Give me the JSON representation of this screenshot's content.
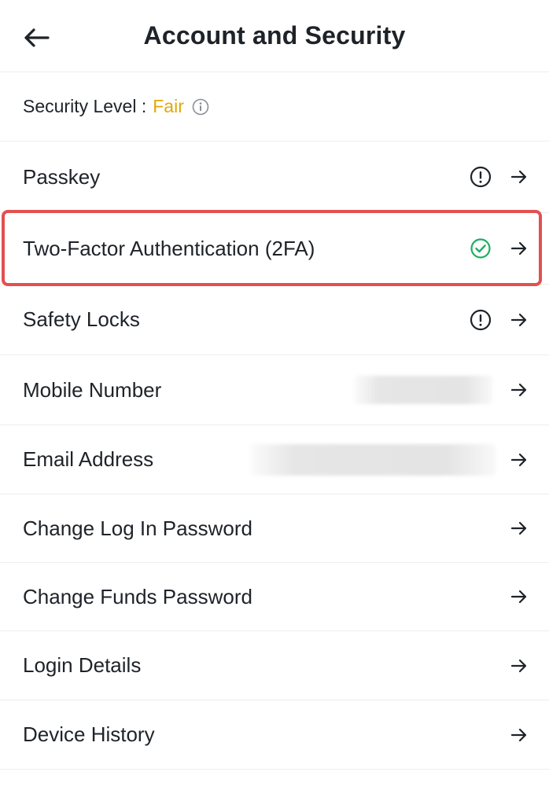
{
  "header": {
    "title": "Account and Security",
    "back_icon": "arrow-left-icon"
  },
  "security_level": {
    "label": "Security Level :",
    "value": "Fair",
    "value_color": "#e0a80a",
    "info_icon": "info-icon"
  },
  "items": [
    {
      "label": "Passkey",
      "status_icon": "warning-icon"
    },
    {
      "label": "Two-Factor Authentication (2FA)",
      "status_icon": "check-circle-icon",
      "status_color": "#1fae61",
      "highlighted": true
    },
    {
      "label": "Safety Locks",
      "status_icon": "warning-icon"
    },
    {
      "label": "Mobile Number",
      "value_redacted": true
    },
    {
      "label": "Email Address",
      "value_redacted": true
    },
    {
      "label": "Change Log In Password"
    },
    {
      "label": "Change Funds Password"
    },
    {
      "label": "Login Details"
    },
    {
      "label": "Device History"
    }
  ],
  "colors": {
    "highlight_border": "#e35050",
    "text": "#1e2329",
    "divider": "#eeeeee"
  }
}
